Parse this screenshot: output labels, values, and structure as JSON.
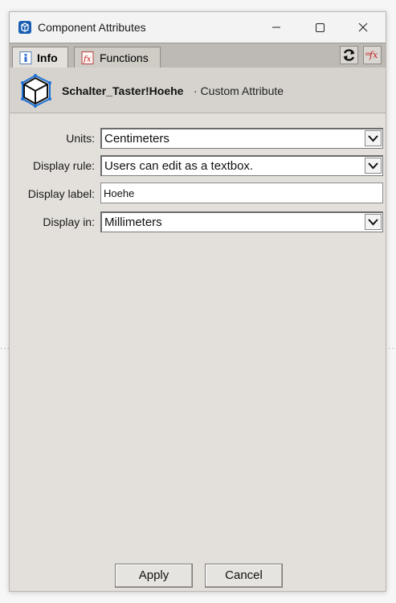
{
  "window": {
    "title": "Component Attributes"
  },
  "tabs": [
    {
      "label": "Info",
      "active": true,
      "icon": "info-icon"
    },
    {
      "label": "Functions",
      "active": false,
      "icon": "function-fx-icon"
    }
  ],
  "toolbar": {
    "refresh_icon": "refresh-icon",
    "fx_icon": "formula-fx-icon"
  },
  "header": {
    "component_name": "Schalter_Taster!Hoehe",
    "subtitle": "· Custom Attribute",
    "icon": "component-cube-icon"
  },
  "form": {
    "units": {
      "label": "Units:",
      "value": "Centimeters"
    },
    "display_rule": {
      "label": "Display rule:",
      "value": "Users can edit as a textbox."
    },
    "display_label": {
      "label": "Display label:",
      "value": "Hoehe"
    },
    "display_in": {
      "label": "Display in:",
      "value": "Millimeters"
    }
  },
  "buttons": {
    "apply": "Apply",
    "cancel": "Cancel"
  },
  "colors": {
    "panel": "#e3e0db",
    "tabstrip": "#bdbab5",
    "accent_blue": "#1e73d8"
  }
}
